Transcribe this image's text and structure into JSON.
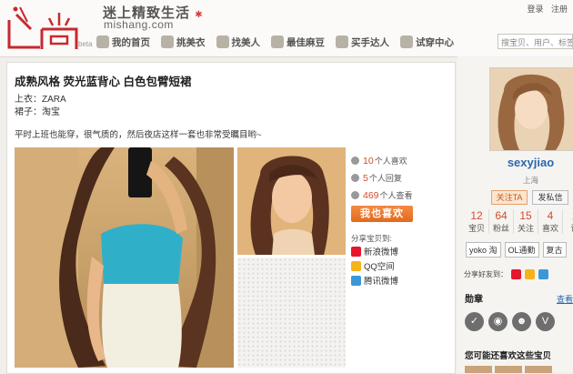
{
  "header": {
    "logo_text": "迷尚",
    "beta": "beta",
    "slogan": "迷上精致生活",
    "domain": "mishang.com",
    "login": "登录",
    "register": "注册",
    "search_placeholder": "搜宝贝、用户、标签",
    "nav": [
      {
        "label": "我的首页",
        "icon": "home-icon"
      },
      {
        "label": "挑美衣",
        "icon": "hanger-icon"
      },
      {
        "label": "找美人",
        "icon": "person-icon"
      },
      {
        "label": "最佳麻豆",
        "icon": "star-icon"
      },
      {
        "label": "买手达人",
        "icon": "hand-icon"
      },
      {
        "label": "试穿中心",
        "icon": "mirror-icon"
      }
    ]
  },
  "post": {
    "title": "成熟风格 荧光蓝背心 白色包臂短裙",
    "top_label": "上衣：ZARA",
    "skirt_label": "裙子：淘宝",
    "description": "平时上班也能穿，很气质的，然后夜店这样一套也非常受瞩目哟~"
  },
  "stats": {
    "likes_count": "10",
    "likes_label": "个人喜欢",
    "replies_count": "5",
    "replies_label": "个人回复",
    "views_count": "469",
    "views_label": "个人查看",
    "like_button": "我也喜欢",
    "share_label": "分享宝贝到:",
    "share_targets": [
      "新浪微博",
      "QQ空间",
      "腾讯微博"
    ]
  },
  "profile": {
    "username": "sexyjiao",
    "city": "上海",
    "follow_button": "关注TA",
    "message_button": "发私信",
    "counts": [
      {
        "value": "12",
        "label": "宝贝"
      },
      {
        "value": "64",
        "label": "粉丝"
      },
      {
        "value": "15",
        "label": "关注"
      },
      {
        "value": "4",
        "label": "喜欢"
      },
      {
        "value": "1",
        "label": "评"
      }
    ],
    "tags": [
      "yoko 淘",
      "OL通勤",
      "复古"
    ],
    "share_friend_label": "分享好友到：",
    "badges_title": "勋章",
    "badges_more": "查看全",
    "may_like_title": "您可能还喜欢这些宝贝"
  }
}
